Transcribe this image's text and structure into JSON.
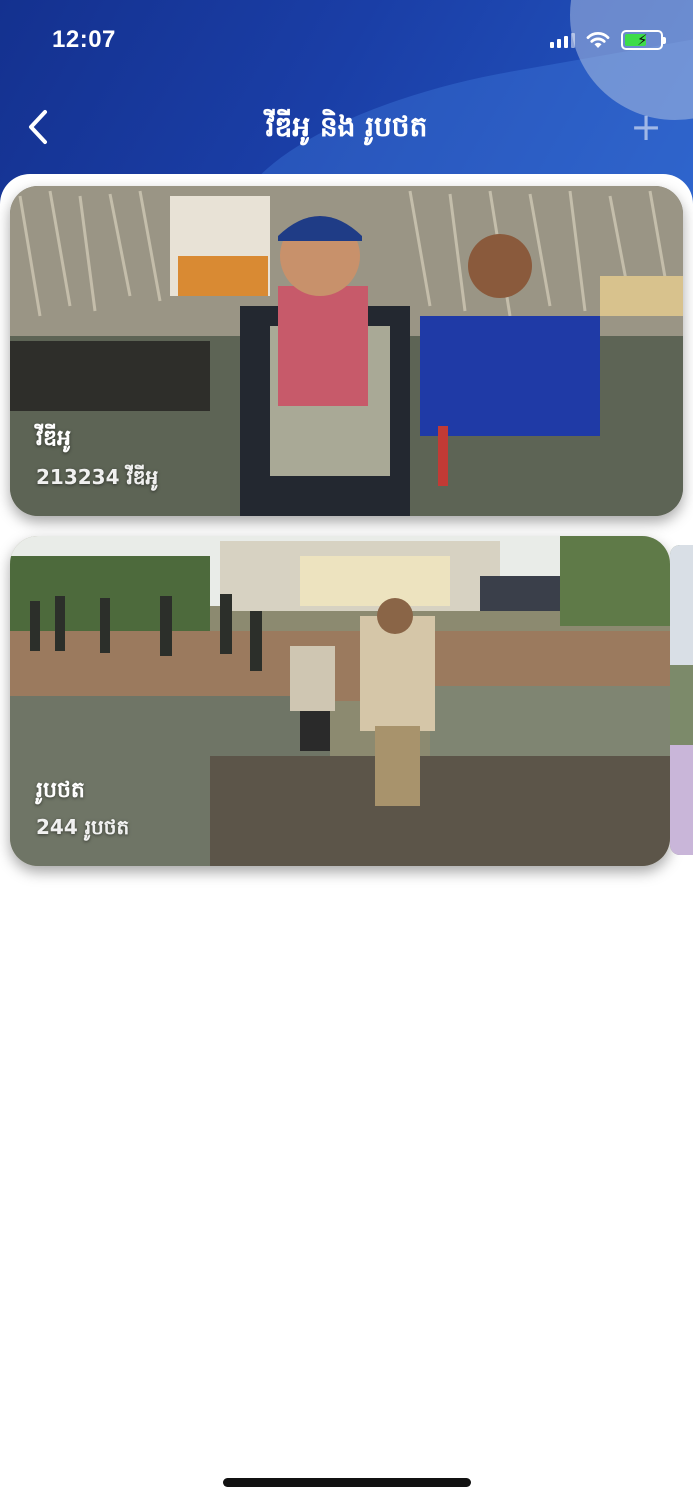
{
  "status_bar": {
    "time": "12:07"
  },
  "nav": {
    "title": "វីឌីអូ និង រូបថត",
    "back_icon": "chevron-left-icon",
    "add_icon": "plus-icon",
    "add_label": "+"
  },
  "albums": [
    {
      "label": "វីឌីអូ",
      "count": "213234 វីឌីអូ"
    },
    {
      "label": "រូបថត",
      "count": "244 រូបថត"
    }
  ],
  "colors": {
    "header_dark": "#14318f",
    "header_light": "#2457c2",
    "battery": "#3ddc4a"
  }
}
